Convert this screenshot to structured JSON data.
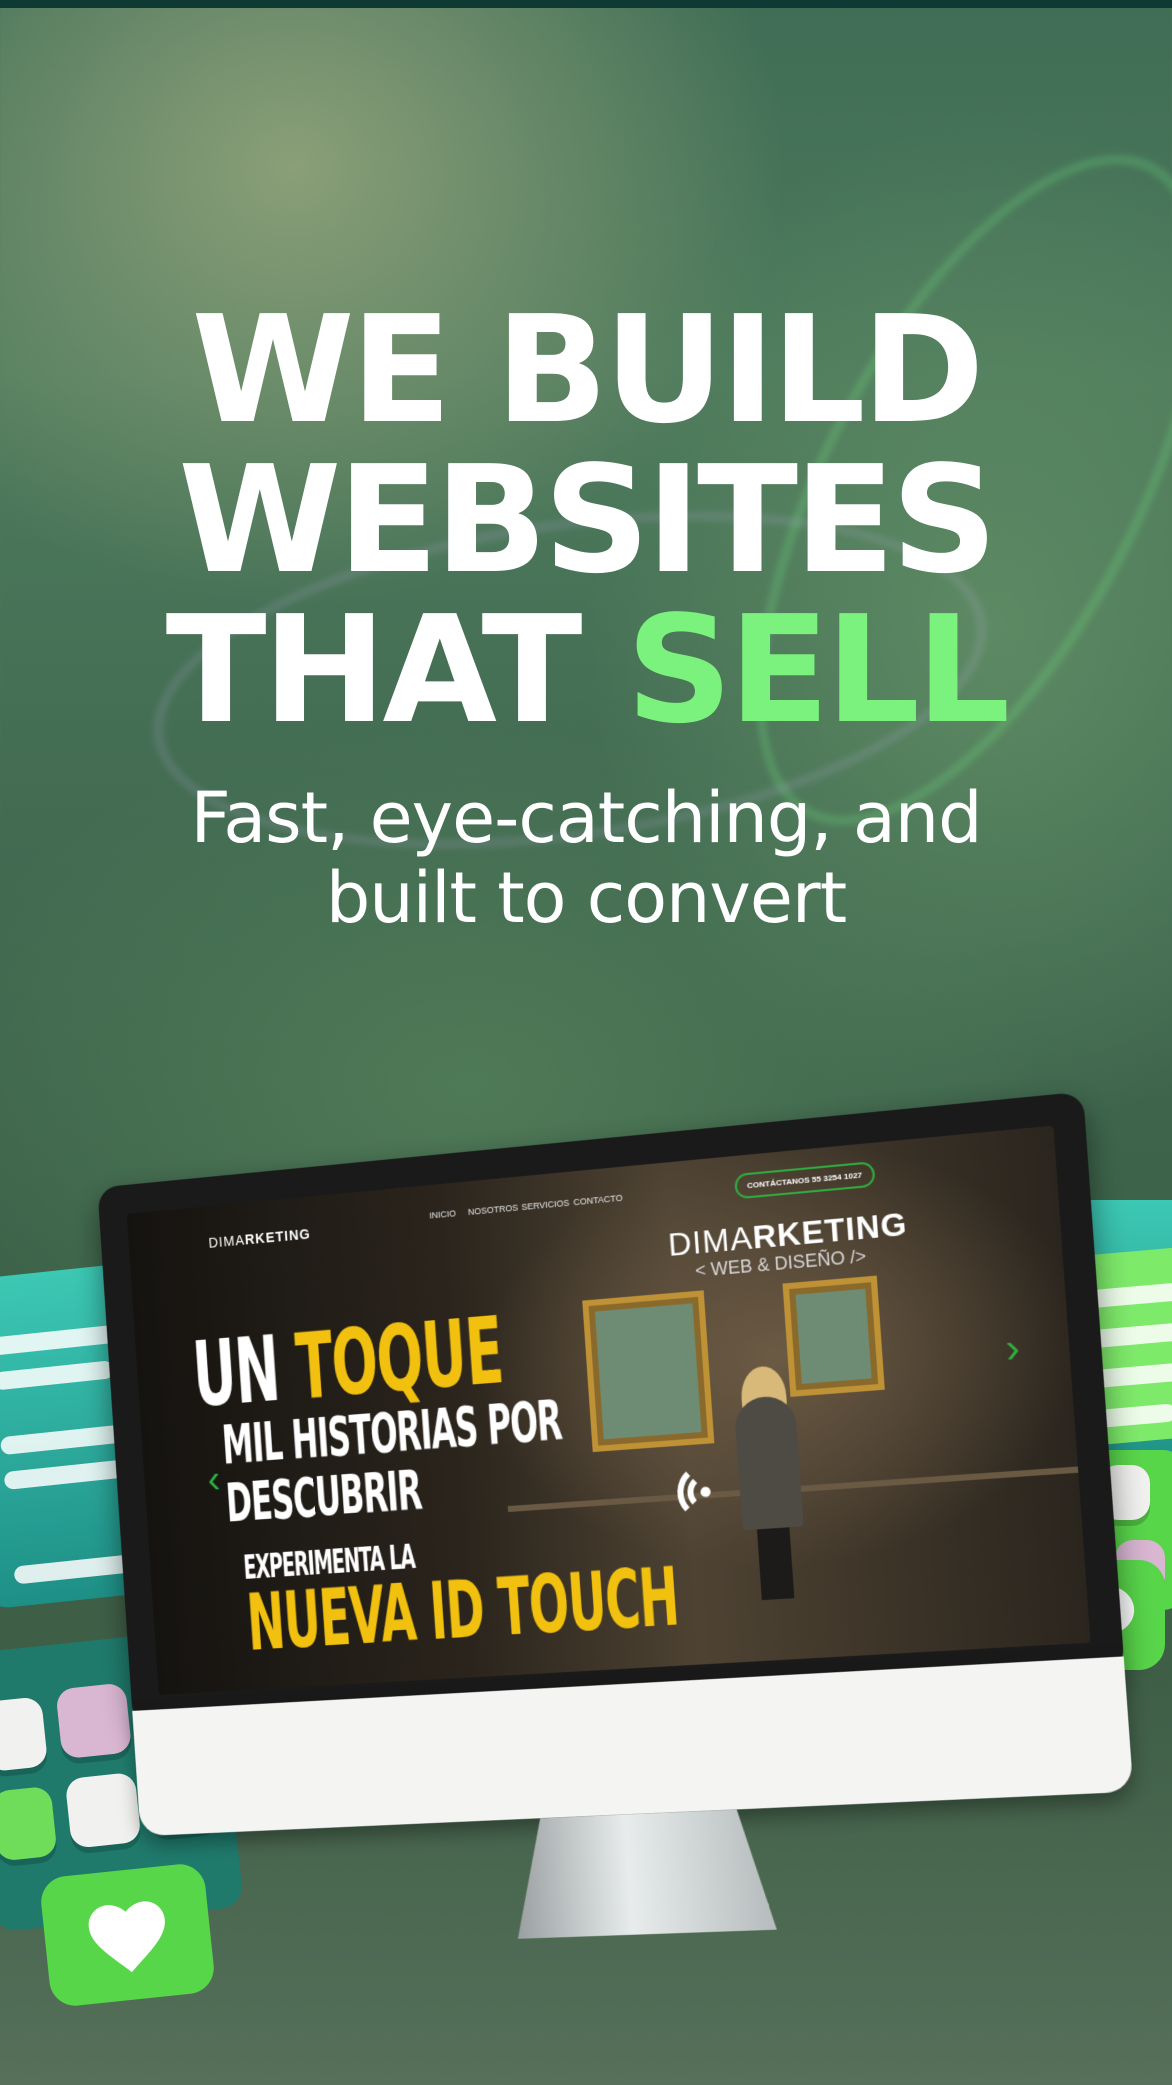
{
  "headline": {
    "line1": "WE BUILD",
    "line2": "WEBSITES",
    "line3_prefix": "THAT ",
    "line3_highlight": "SELL"
  },
  "subheadline": {
    "line1": "Fast, eye-catching, and",
    "line2": "built to convert"
  },
  "mockup_site": {
    "nav_logo_light": "DIMA",
    "nav_logo_bold": "RKETING",
    "nav_items": [
      "INICIO",
      "NOSOTROS",
      "SERVICIOS",
      "CONTACTO"
    ],
    "cta": "CONTÁCTANOS  55 3254 1027",
    "brand_light": "DIMA",
    "brand_bold": "RKETING",
    "brand_tagline": "< WEB & DISEÑO />",
    "hero_un": "UN ",
    "hero_toque": "TOQUE",
    "hero_line2": "MIL HISTORIAS POR",
    "hero_line3": "DESCUBRIR",
    "hero_line4": "EXPERIMENTA LA",
    "hero_line5": "NUEVA ID TOUCH"
  },
  "icons": {
    "heart": "heart-icon",
    "chat": "chat-bubble-icon",
    "prev": "chevron-left-icon",
    "next": "chevron-right-icon",
    "contactless": "contactless-icon"
  },
  "colors": {
    "accent_green": "#7bf27d",
    "hero_yellow": "#f2c10f",
    "cta_border": "#2fae3f"
  }
}
